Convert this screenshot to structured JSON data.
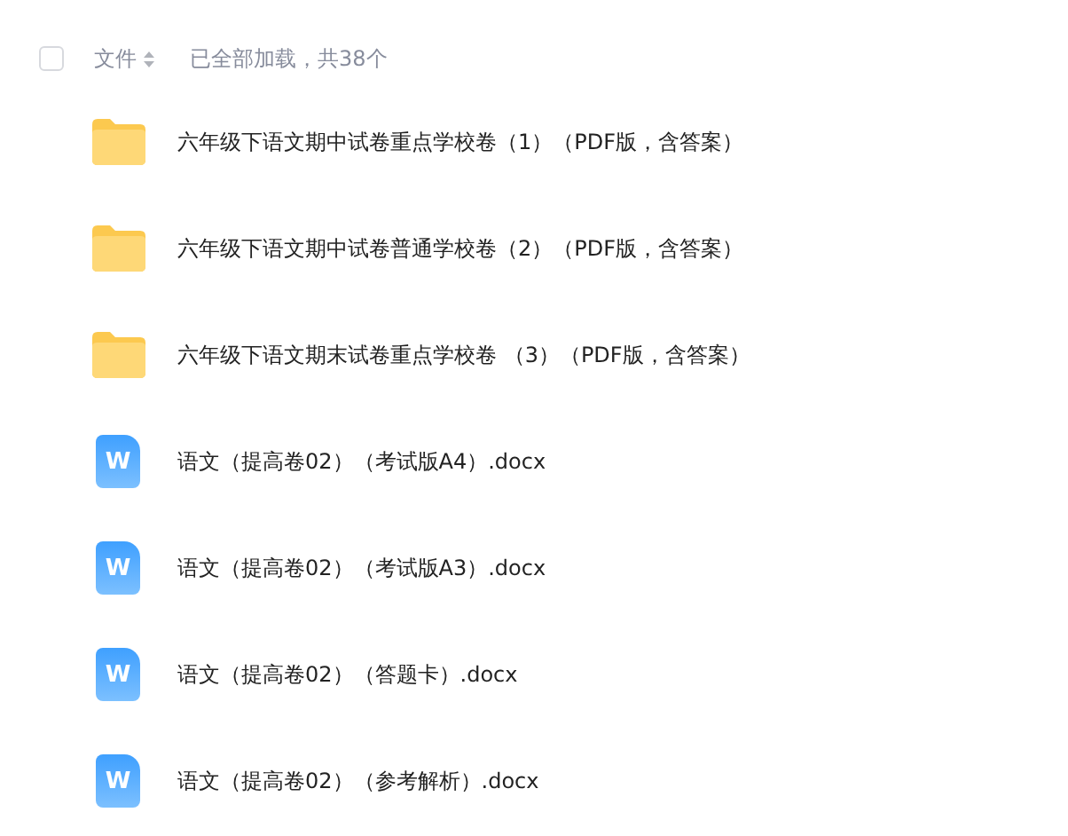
{
  "header": {
    "select_all": {
      "checked": false
    },
    "column": "文件",
    "summary": "已全部加载，共38个"
  },
  "files": [
    {
      "kind": "folder",
      "name": "六年级下语文期中试卷重点学校卷（1）（PDF版，含答案）"
    },
    {
      "kind": "folder",
      "name": "六年级下语文期中试卷普通学校卷（2）（PDF版，含答案）"
    },
    {
      "kind": "folder",
      "name": "六年级下语文期末试卷重点学校卷 （3）（PDF版，含答案）"
    },
    {
      "kind": "docx",
      "icon_letter": "W",
      "name": "语文（提高卷02）（考试版A4）.docx"
    },
    {
      "kind": "docx",
      "icon_letter": "W",
      "name": "语文（提高卷02）（考试版A3）.docx"
    },
    {
      "kind": "docx",
      "icon_letter": "W",
      "name": "语文（提高卷02）（答题卡）.docx"
    },
    {
      "kind": "docx",
      "icon_letter": "W",
      "name": "语文（提高卷02）（参考解析）.docx"
    }
  ]
}
